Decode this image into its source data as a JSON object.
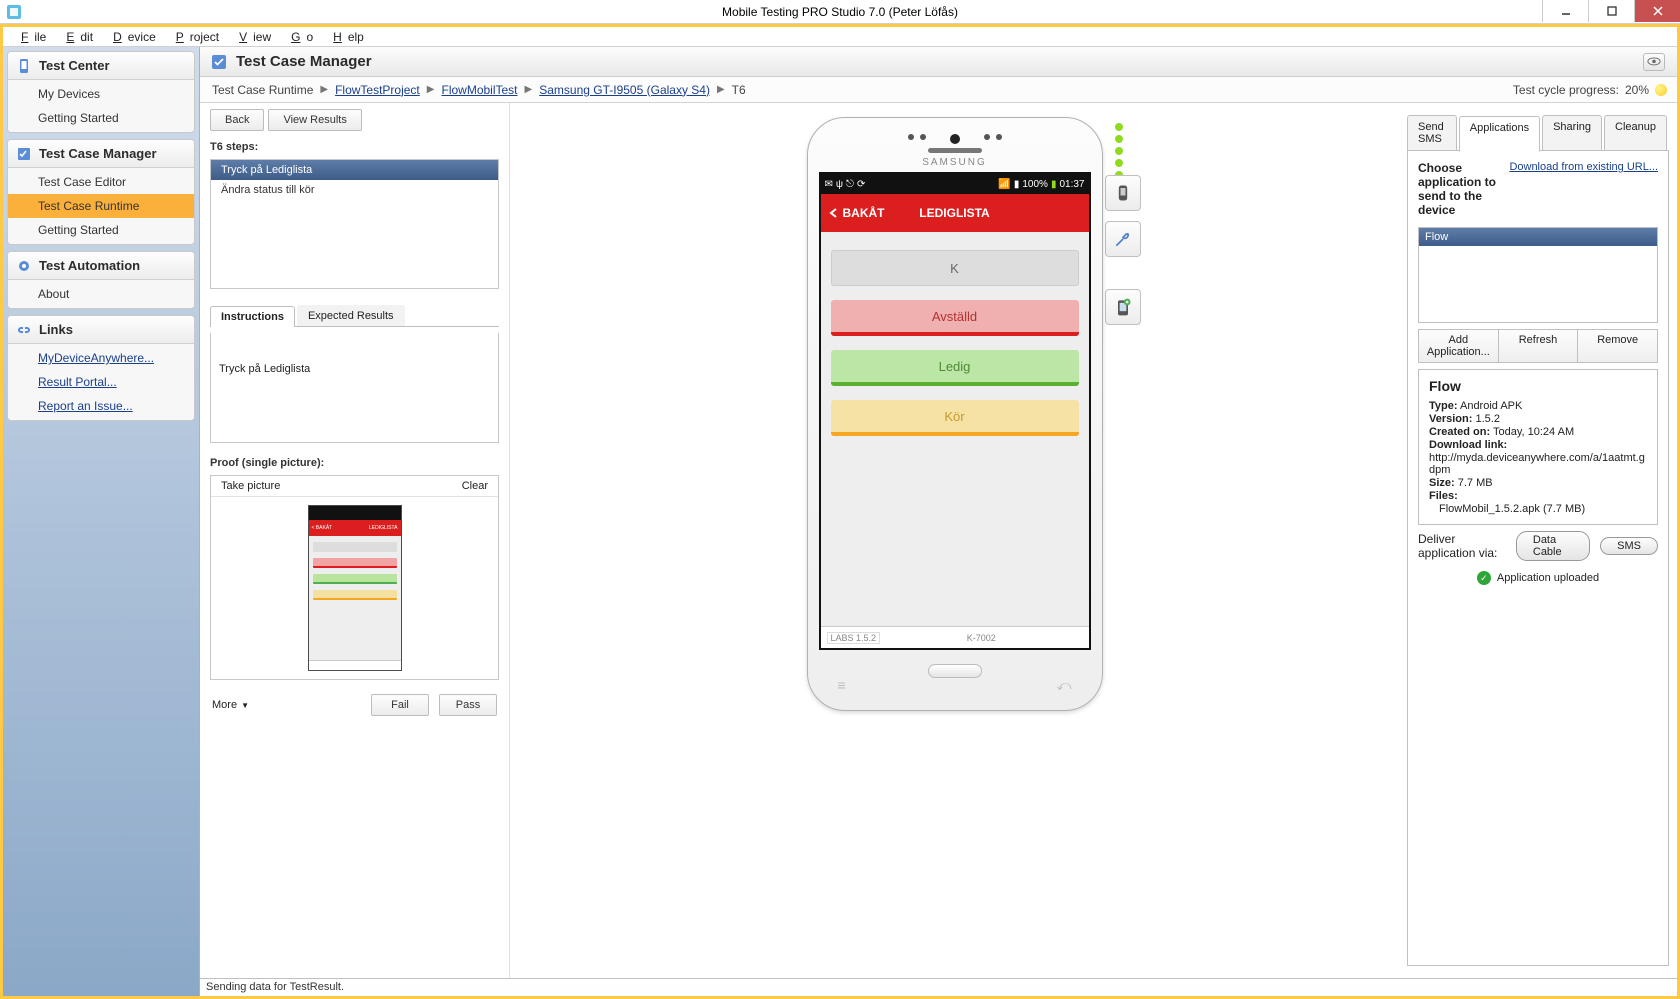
{
  "window": {
    "title": "Mobile Testing PRO Studio 7.0 (Peter Löfås)"
  },
  "menubar": [
    "File",
    "Edit",
    "Device",
    "Project",
    "View",
    "Go",
    "Help"
  ],
  "sidebar": {
    "panels": [
      {
        "title": "Test Center",
        "items": [
          {
            "label": "My Devices"
          },
          {
            "label": "Getting Started"
          }
        ]
      },
      {
        "title": "Test Case Manager",
        "items": [
          {
            "label": "Test Case Editor"
          },
          {
            "label": "Test Case Runtime",
            "selected": true
          },
          {
            "label": "Getting Started"
          }
        ]
      },
      {
        "title": "Test Automation",
        "items": [
          {
            "label": "About"
          }
        ]
      },
      {
        "title": "Links",
        "items": [
          {
            "label": "MyDeviceAnywhere...",
            "link": true
          },
          {
            "label": "Result Portal...",
            "link": true
          },
          {
            "label": "Report an Issue...",
            "link": true
          }
        ]
      }
    ]
  },
  "header": {
    "title": "Test Case Manager"
  },
  "breadcrumb": {
    "root": "Test Case Runtime",
    "items": [
      "FlowTestProject",
      "FlowMobilTest",
      "Samsung GT-I9505 (Galaxy S4)"
    ],
    "current": "T6",
    "progressLabel": "Test cycle progress:",
    "progressValue": "20%"
  },
  "toolbar": {
    "back": "Back",
    "viewResults": "View Results"
  },
  "steps": {
    "label": "T6 steps:",
    "items": [
      {
        "text": "Tryck på Lediglista",
        "selected": true
      },
      {
        "text": "Ändra status till kör"
      }
    ]
  },
  "instructions": {
    "tabs": [
      "Instructions",
      "Expected Results"
    ],
    "selected": 0,
    "text": "Tryck på Lediglista"
  },
  "proof": {
    "label": "Proof (single picture):",
    "take": "Take picture",
    "clear": "Clear"
  },
  "footer": {
    "more": "More",
    "fail": "Fail",
    "pass": "Pass"
  },
  "phone": {
    "brand": "SAMSUNG",
    "status": {
      "time": "01:37",
      "battery": "100%"
    },
    "app": {
      "back": "BAKÅT",
      "title": "LEDIGLISTA",
      "search": "K",
      "buttons": {
        "av": "Avställd",
        "le": "Ledig",
        "ko": "Kör"
      },
      "footerLeft": "LABS 1.5.2",
      "footerRight": "K-7002"
    }
  },
  "rightTabs": [
    "Send SMS",
    "Applications",
    "Sharing",
    "Cleanup"
  ],
  "rightSelected": 1,
  "apps": {
    "heading": "Choose application to send to the device",
    "downloadLink": "Download from existing URL...",
    "list": [
      "Flow"
    ],
    "btns": {
      "add": "Add Application...",
      "refresh": "Refresh",
      "remove": "Remove"
    },
    "detail": {
      "name": "Flow",
      "type_l": "Type:",
      "type_v": "Android APK",
      "ver_l": "Version:",
      "ver_v": "1.5.2",
      "created_l": "Created on:",
      "created_v": "Today, 10:24 AM",
      "dl_l": "Download link:",
      "dl_v": "http://myda.deviceanywhere.com/a/1aatmt.gdpm",
      "size_l": "Size:",
      "size_v": "7.7 MB",
      "files_l": "Files:",
      "files_v": "FlowMobil_1.5.2.apk (7.7 MB)"
    },
    "deliverLabel": "Deliver application via:",
    "deliverBtns": {
      "cable": "Data Cable",
      "sms": "SMS"
    },
    "status": "Application uploaded"
  },
  "status": "Sending data for TestResult."
}
